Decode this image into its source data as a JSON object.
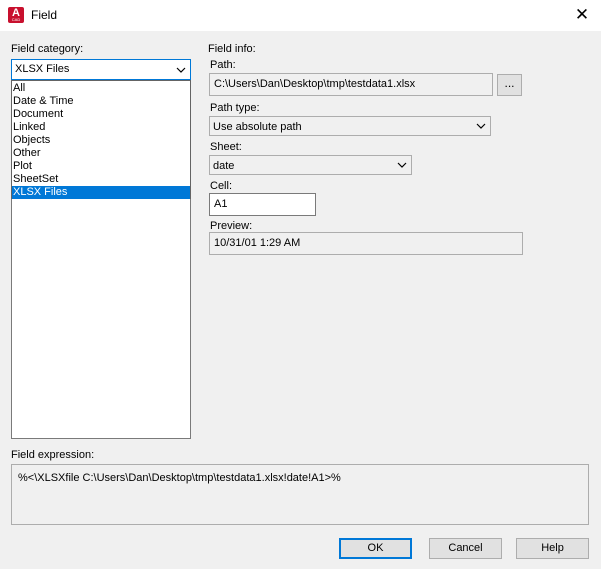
{
  "window": {
    "title": "Field",
    "close_glyph": "✕",
    "icon_letter": "A",
    "icon_sublabel": "CAD"
  },
  "field_category": {
    "label": "Field category:",
    "selected": "XLSX Files",
    "options": [
      "All",
      "Date & Time",
      "Document",
      "Linked",
      "Objects",
      "Other",
      "Plot",
      "SheetSet",
      "XLSX Files"
    ],
    "highlighted_index": 8
  },
  "field_info": {
    "label": "Field info:",
    "path_label": "Path:",
    "path_value": "C:\\Users\\Dan\\Desktop\\tmp\\testdata1.xlsx",
    "browse_label": "...",
    "path_type_label": "Path type:",
    "path_type_value": "Use absolute path",
    "sheet_label": "Sheet:",
    "sheet_value": "date",
    "cell_label": "Cell:",
    "cell_value": "A1",
    "preview_label": "Preview:",
    "preview_value": "10/31/01 1:29 AM"
  },
  "field_expression": {
    "label": "Field expression:",
    "value": "%<\\XLSXfile C:\\Users\\Dan\\Desktop\\tmp\\testdata1.xlsx!date!A1>%"
  },
  "buttons": {
    "ok": "OK",
    "cancel": "Cancel",
    "help": "Help"
  },
  "colors": {
    "accent": "#0078d7",
    "brand": "#c8102e",
    "dialog_bg": "#f0f0f0"
  }
}
